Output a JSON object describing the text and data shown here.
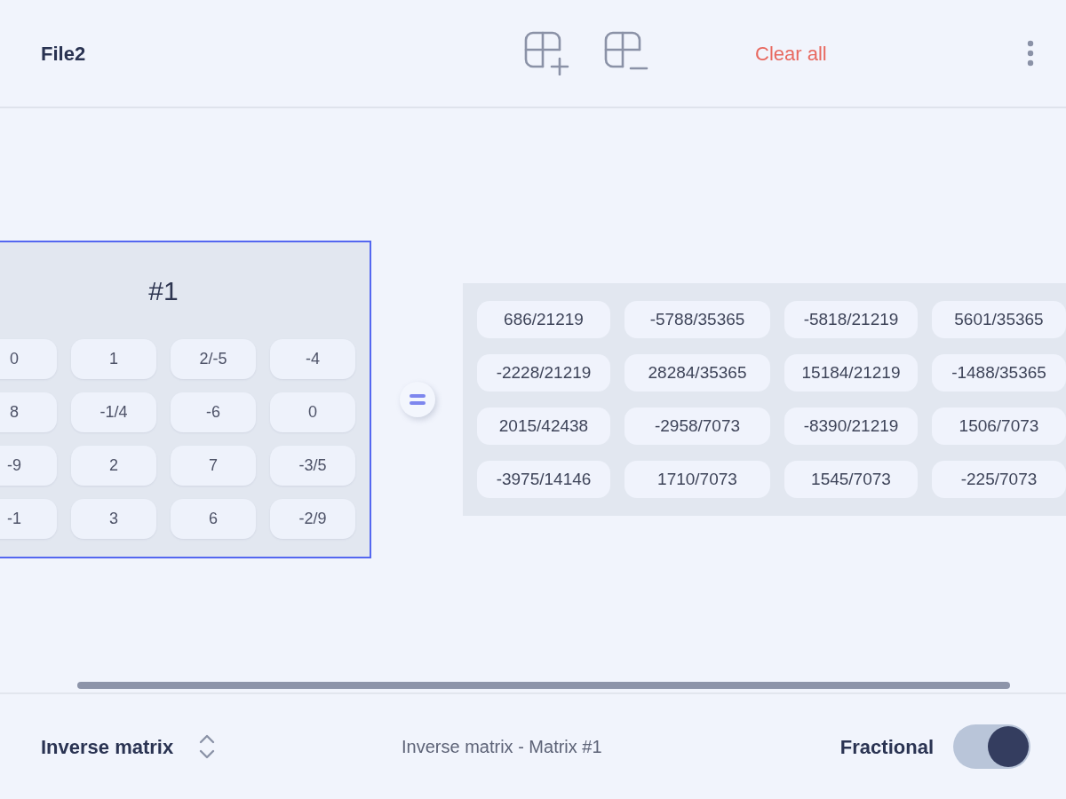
{
  "header": {
    "title": "File2",
    "clear_button": "Clear all"
  },
  "matrix": {
    "label": "#1",
    "selected": true,
    "rows": [
      [
        "0",
        "1",
        "2/-5",
        "-4"
      ],
      [
        "8",
        "-1/4",
        "-6",
        "0"
      ],
      [
        "-9",
        "2",
        "7",
        "-3/5"
      ],
      [
        "-1",
        "3",
        "6",
        "-2/9"
      ]
    ]
  },
  "result": {
    "rows": [
      [
        "686/21219",
        "-5788/35365",
        "-5818/21219",
        "5601/35365"
      ],
      [
        "-2228/21219",
        "28284/35365",
        "15184/21219",
        "-1488/35365"
      ],
      [
        "2015/42438",
        "-2958/7073",
        "-8390/21219",
        "1506/7073"
      ],
      [
        "-3975/14146",
        "1710/7073",
        "1545/7073",
        "-225/7073"
      ]
    ]
  },
  "footer": {
    "operation": "Inverse matrix",
    "description": "Inverse matrix - Matrix #1",
    "toggle": {
      "label": "Fractional",
      "on": true
    }
  }
}
